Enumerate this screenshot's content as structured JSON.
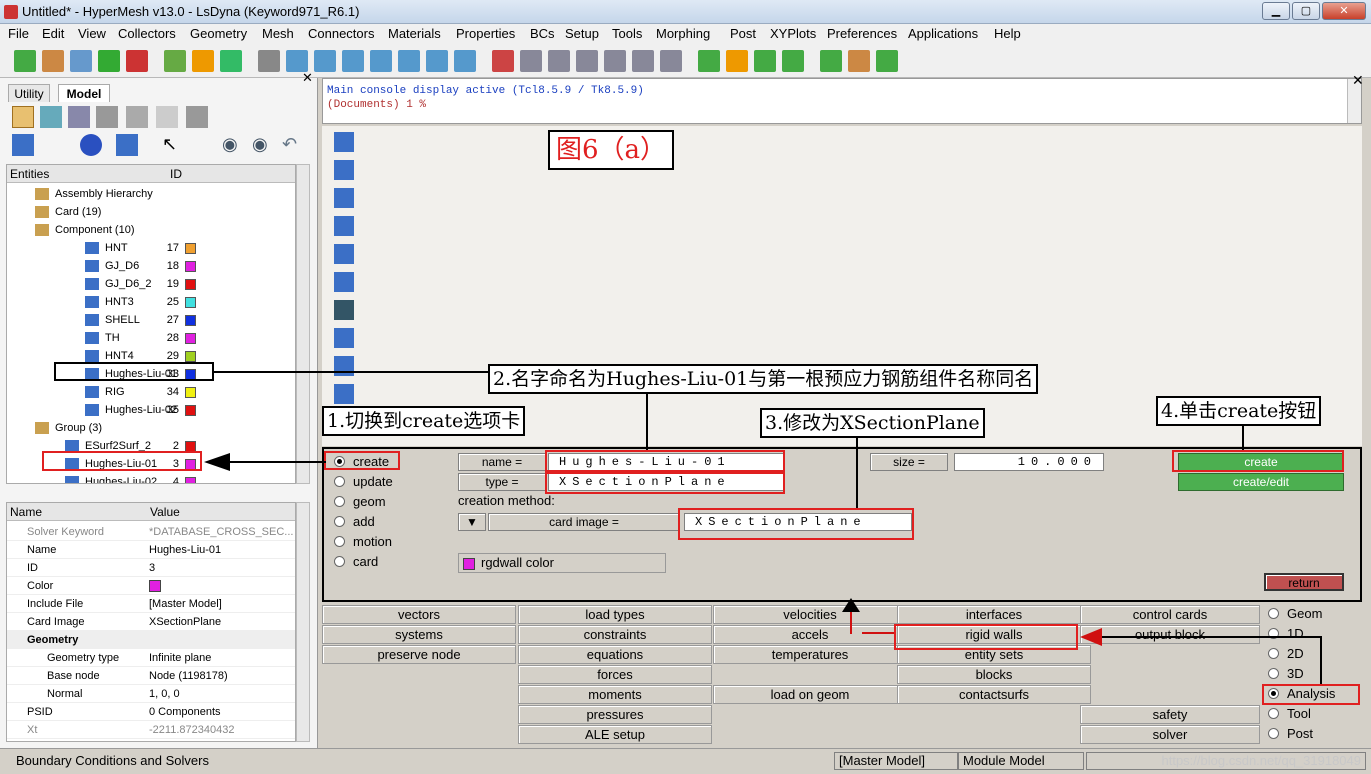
{
  "window": {
    "title": "Untitled* - HyperMesh v13.0 - LsDyna (Keyword971_R6.1)"
  },
  "menu": [
    "File",
    "Edit",
    "View",
    "Collectors",
    "Geometry",
    "Mesh",
    "Connectors",
    "Materials",
    "Properties",
    "BCs",
    "Setup",
    "Tools",
    "Morphing",
    "Post",
    "XYPlots",
    "Preferences",
    "Applications",
    "Help"
  ],
  "left": {
    "tabs": [
      "Utility",
      "Model"
    ],
    "entities_header": "Entities",
    "id_header": "ID",
    "tree": [
      {
        "label": "Assembly Hierarchy",
        "id": "",
        "color": ""
      },
      {
        "label": "Card (19)",
        "id": "",
        "color": ""
      },
      {
        "label": "Component (10)",
        "id": "",
        "color": ""
      },
      {
        "label": "HNT",
        "id": "17",
        "color": "#f0a030"
      },
      {
        "label": "GJ_D6",
        "id": "18",
        "color": "#e020e0"
      },
      {
        "label": "GJ_D6_2",
        "id": "19",
        "color": "#e01010"
      },
      {
        "label": "HNT3",
        "id": "25",
        "color": "#40e0e0"
      },
      {
        "label": "SHELL",
        "id": "27",
        "color": "#1030e0"
      },
      {
        "label": "TH",
        "id": "28",
        "color": "#e020e0"
      },
      {
        "label": "HNT4",
        "id": "29",
        "color": "#a0d020"
      },
      {
        "label": "Hughes-Liu-01",
        "id": "33",
        "color": "#1030e0"
      },
      {
        "label": "RIG",
        "id": "34",
        "color": "#f0f010"
      },
      {
        "label": "Hughes-Liu-02",
        "id": "35",
        "color": "#e01010"
      },
      {
        "label": "Group (3)",
        "id": "",
        "color": ""
      },
      {
        "label": "ESurf2Surf_2",
        "id": "2",
        "color": "#e01010"
      },
      {
        "label": "Hughes-Liu-01",
        "id": "3",
        "color": "#e020e0"
      },
      {
        "label": "Hughes-Liu-02",
        "id": "4",
        "color": "#e020e0"
      }
    ],
    "props_header_name": "Name",
    "props_header_value": "Value",
    "props": [
      {
        "n": "Solver Keyword",
        "v": "*DATABASE_CROSS_SEC..."
      },
      {
        "n": "Name",
        "v": "Hughes-Liu-01"
      },
      {
        "n": "ID",
        "v": "3"
      },
      {
        "n": "Color",
        "v": ""
      },
      {
        "n": "Include File",
        "v": "[Master Model]"
      },
      {
        "n": "Card Image",
        "v": "XSectionPlane"
      },
      {
        "n": "Geometry",
        "v": ""
      },
      {
        "n": "Geometry type",
        "v": "Infinite plane"
      },
      {
        "n": "Base node",
        "v": "Node (1198178)"
      },
      {
        "n": "Normal",
        "v": "1, 0, 0"
      },
      {
        "n": "PSID",
        "v": "0 Components"
      },
      {
        "n": "Xt",
        "v": "-2211.872340432"
      }
    ]
  },
  "console": {
    "line1": "Main console display active (Tcl8.5.9 / Tk8.5.9)",
    "line2": "(Documents) 1 %"
  },
  "figure_label": "图6（a）",
  "annotations": {
    "a1": "1.切换到create选项卡",
    "a2": "2.名字命名为Hughes-Liu-01与第一根预应力钢筋组件名称同名",
    "a3": "3.修改为XSectionPlane",
    "a4": "4.单击create按钮"
  },
  "panel": {
    "radios": [
      "create",
      "update",
      "geom",
      "add",
      "motion",
      "card"
    ],
    "name_label": "name =",
    "name_value": "Hughes-Liu-01",
    "type_label": "type =",
    "type_value": "XSectionPlane",
    "creation_method": "creation method:",
    "card_image_label": "card image =",
    "card_image_value": "XSectionPlane",
    "size_label": "size =",
    "size_value": "10.000",
    "color_label": "rgdwall  color",
    "create": "create",
    "create_edit": "create/edit",
    "return": "return"
  },
  "pages": {
    "col1": [
      "vectors",
      "systems",
      "preserve node"
    ],
    "col2": [
      "load types",
      "constraints",
      "equations",
      "forces",
      "moments",
      "pressures",
      "ALE setup"
    ],
    "col3": [
      "velocities",
      "accels",
      "temperatures",
      "",
      "load on geom"
    ],
    "col4": [
      "interfaces",
      "rigid walls",
      "entity sets",
      "blocks",
      "contactsurfs"
    ],
    "col5": [
      "control cards",
      "output block",
      "",
      "",
      "",
      "safety",
      "solver"
    ],
    "radios": [
      "Geom",
      "1D",
      "2D",
      "3D",
      "Analysis",
      "Tool",
      "Post"
    ]
  },
  "status": {
    "left": "Boundary Conditions and Solvers",
    "model": "[Master Model]",
    "module": "Module Model",
    "watermark": "https://blog.csdn.net/qq_31918049"
  }
}
